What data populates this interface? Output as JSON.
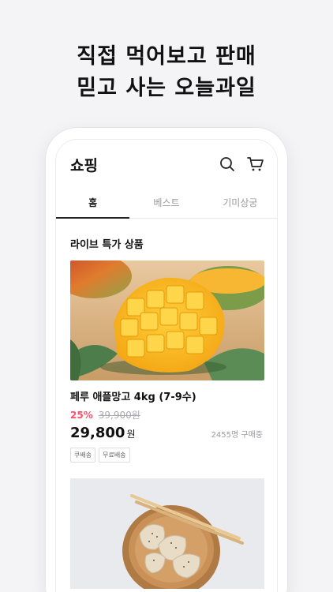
{
  "headline": {
    "line1": "직접 먹어보고 판매",
    "line2": "믿고 사는 오늘과일"
  },
  "app": {
    "title": "쇼핑",
    "icons": [
      "search-icon",
      "cart-icon"
    ]
  },
  "tabs": [
    {
      "label": "홈",
      "active": true
    },
    {
      "label": "베스트",
      "active": false
    },
    {
      "label": "기미상궁",
      "active": false
    }
  ],
  "section": {
    "title": "라이브 특가 상품"
  },
  "product": {
    "name": "페루 애플망고 4kg (7-9수)",
    "discount": "25%",
    "original_price": "39,900원",
    "sale_price": "29,800",
    "currency": "원",
    "buyers": "2455명 구매중",
    "badges": [
      "쿠배송",
      "무료배송"
    ]
  },
  "colors": {
    "accent_discount": "#ff4f6a",
    "background": "#f4f4f6"
  }
}
